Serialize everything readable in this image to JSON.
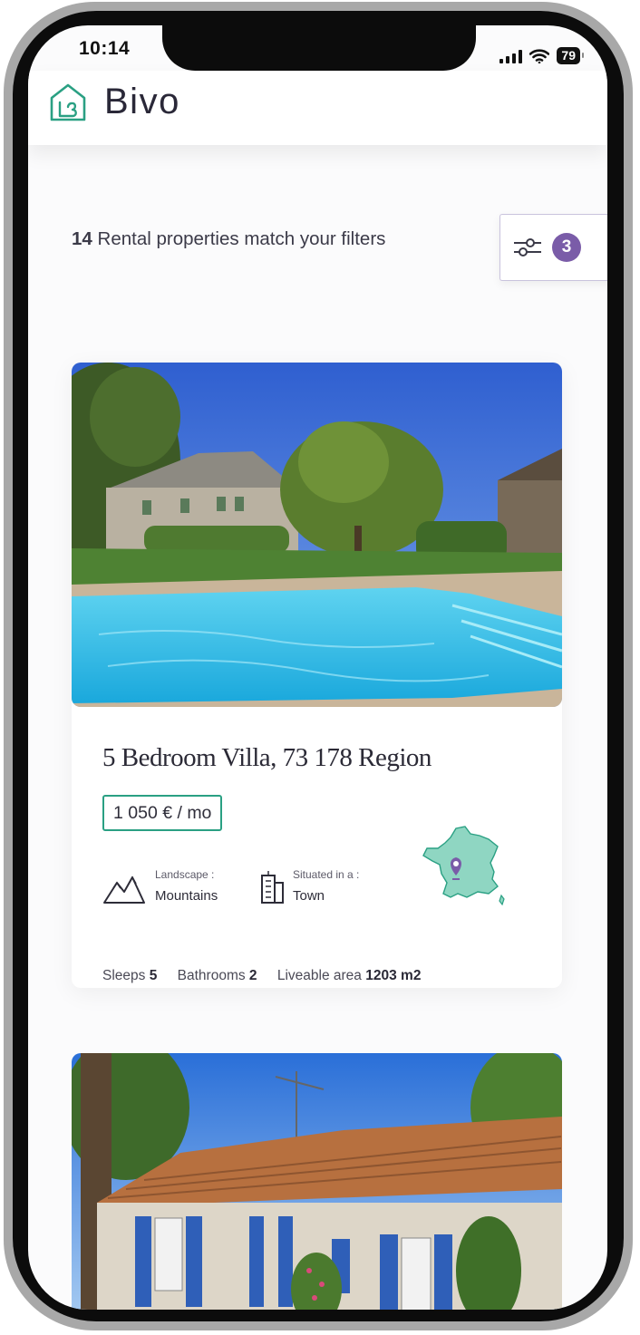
{
  "status_bar": {
    "time": "10:14",
    "battery": "79"
  },
  "header": {
    "brand": "Bivo"
  },
  "results": {
    "count": "14",
    "text": "Rental properties match your filters"
  },
  "filters": {
    "active_count": "3"
  },
  "listings": [
    {
      "title": "5 Bedroom Villa, 73 178 Region",
      "price": "1 050 € / mo",
      "landscape_label": "Landscape :",
      "landscape_value": "Mountains",
      "situated_label": "Situated in a :",
      "situated_value": "Town",
      "sleeps_label": "Sleeps",
      "sleeps_value": "5",
      "bathrooms_label": "Bathrooms",
      "bathrooms_value": "2",
      "area_label": "Liveable area",
      "area_value": "1203 m2"
    }
  ],
  "colors": {
    "brand_green": "#2aa083",
    "accent_purple": "#7a5ca8",
    "map_fill": "#8fd6c2"
  }
}
